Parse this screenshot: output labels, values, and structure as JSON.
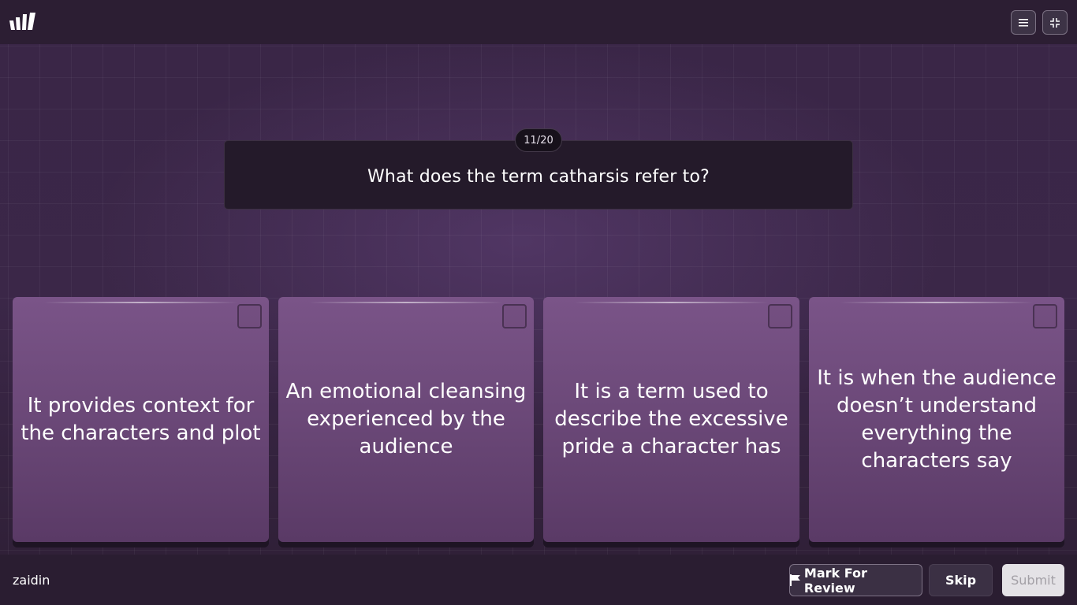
{
  "header": {
    "menu_icon": "hamburger-icon",
    "exit_fullscreen_icon": "exit-fullscreen-icon"
  },
  "question": {
    "counter": "11/20",
    "text": "What does the term catharsis refer to?"
  },
  "options": [
    {
      "text": "It provides context for the characters and plot"
    },
    {
      "text": "An emotional cleansing experienced by the audience"
    },
    {
      "text": "It is a term used to describe the excessive pride a character has"
    },
    {
      "text": "It is when the audience doesn’t understand everything the characters say"
    }
  ],
  "footer": {
    "username": "zaidin",
    "mark_review_label": "Mark For Review",
    "skip_label": "Skip",
    "submit_label": "Submit"
  },
  "colors": {
    "background": "#2b1c33",
    "option_card": "#6c4979",
    "question_box": "#241a2a",
    "submit_disabled": "#e4e2e6"
  }
}
